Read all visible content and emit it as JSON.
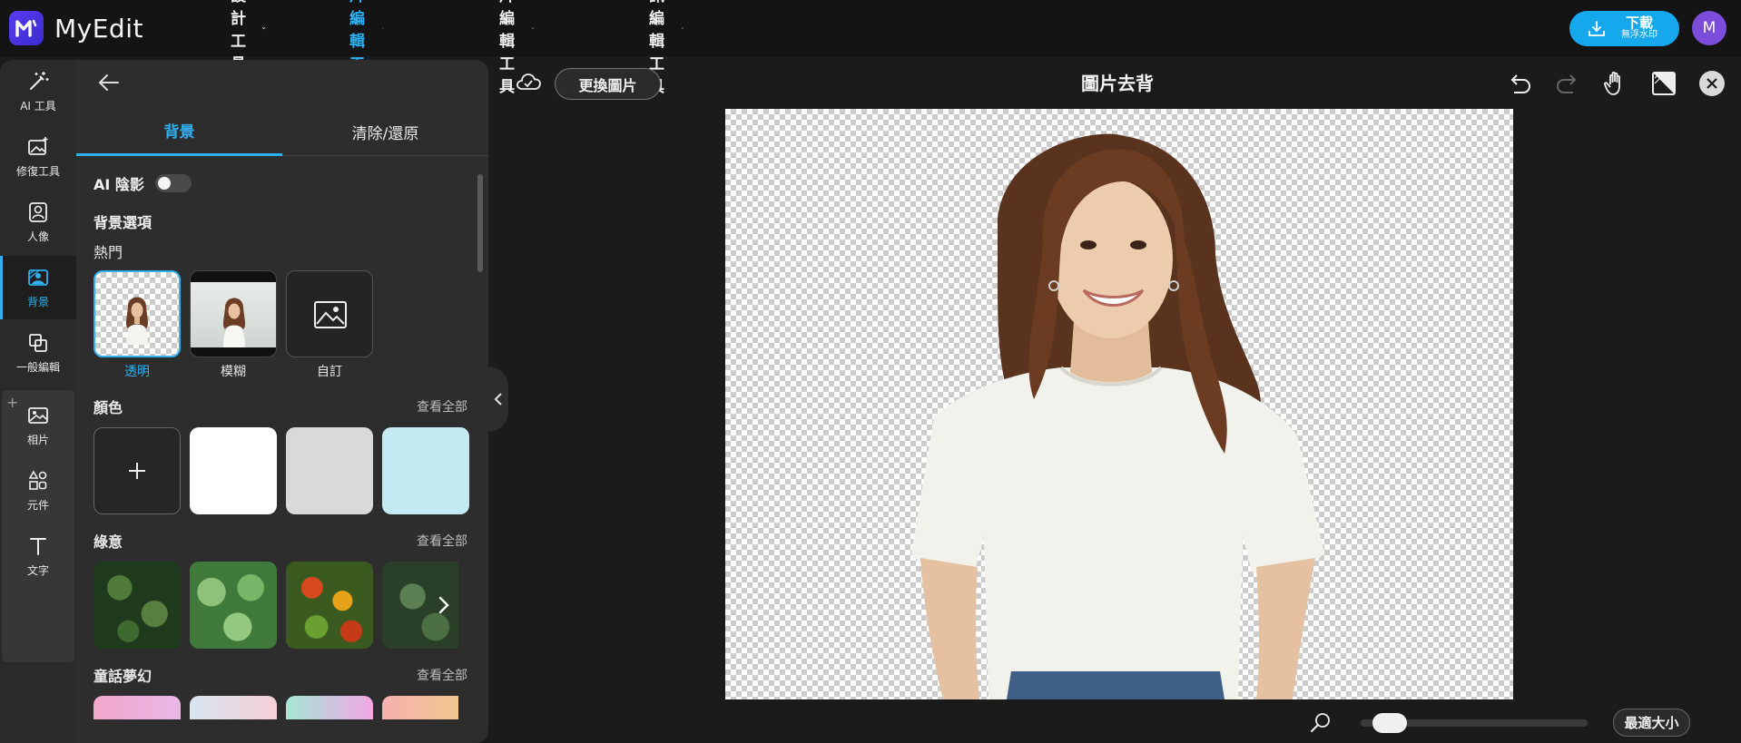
{
  "app": {
    "name": "MyEdit"
  },
  "nav": [
    {
      "label": "設計工具",
      "active": false
    },
    {
      "label": "圖片編輯工具",
      "active": true
    },
    {
      "label": "影片編輯工具",
      "active": false
    },
    {
      "label": "音訊編輯工具",
      "active": false
    }
  ],
  "download": {
    "label": "下載",
    "sublabel": "無浮水印"
  },
  "user": {
    "initial": "M"
  },
  "rail": [
    {
      "label": "AI 工具",
      "icon": "magic-wand-icon"
    },
    {
      "label": "修復工具",
      "icon": "image-sparkle-icon"
    },
    {
      "label": "人像",
      "icon": "portrait-icon"
    },
    {
      "label": "背景",
      "icon": "background-icon",
      "active": true
    },
    {
      "label": "一般編輯",
      "icon": "copy-icon"
    },
    {
      "label": "相片",
      "icon": "photo-icon"
    },
    {
      "label": "元件",
      "icon": "shapes-icon"
    },
    {
      "label": "文字",
      "icon": "text-icon"
    }
  ],
  "panel": {
    "tabs": [
      "背景",
      "清除/還原"
    ],
    "ai_shadow": {
      "label": "AI 陰影",
      "enabled": false
    },
    "bg_options_title": "背景選項",
    "popular_title": "熱門",
    "popular": [
      {
        "label": "透明",
        "selected": true
      },
      {
        "label": "模糊",
        "selected": false
      },
      {
        "label": "自訂",
        "selected": false
      }
    ],
    "color_title": "顏色",
    "colors": [
      "#ffffff",
      "#d9d9d9",
      "#c5e9f3"
    ],
    "green_title": "綠意",
    "fairy_title": "童話夢幻",
    "see_all": "查看全部"
  },
  "workspace": {
    "replace_label": "更換圖片",
    "title": "圖片去背",
    "fit_label": "最適大小",
    "zoom_fraction": 0.06
  }
}
